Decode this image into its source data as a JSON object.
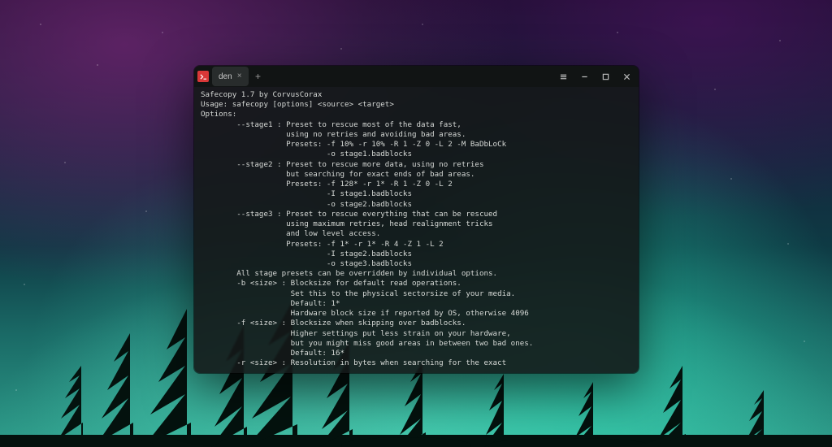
{
  "titlebar": {
    "tab_label": "den",
    "new_tab_tooltip": "+"
  },
  "terminal": {
    "lines": [
      "Safecopy 1.7 by CorvusCorax",
      "Usage: safecopy [options] <source> <target>",
      "Options:",
      "        --stage1 : Preset to rescue most of the data fast,",
      "                   using no retries and avoiding bad areas.",
      "                   Presets: -f 10% -r 10% -R 1 -Z 0 -L 2 -M BaDbLoCk",
      "                            -o stage1.badblocks",
      "        --stage2 : Preset to rescue more data, using no retries",
      "                   but searching for exact ends of bad areas.",
      "                   Presets: -f 128* -r 1* -R 1 -Z 0 -L 2",
      "                            -I stage1.badblocks",
      "                            -o stage2.badblocks",
      "        --stage3 : Preset to rescue everything that can be rescued",
      "                   using maximum retries, head realignment tricks",
      "                   and low level access.",
      "                   Presets: -f 1* -r 1* -R 4 -Z 1 -L 2",
      "                            -I stage2.badblocks",
      "                            -o stage3.badblocks",
      "        All stage presets can be overridden by individual options.",
      "        -b <size> : Blocksize for default read operations.",
      "                    Set this to the physical sectorsize of your media.",
      "                    Default: 1*",
      "                    Hardware block size if reported by OS, otherwise 4096",
      "        -f <size> : Blocksize when skipping over badblocks.",
      "                    Higher settings put less strain on your hardware,",
      "                    but you might miss good areas in between two bad ones.",
      "                    Default: 16*",
      "        -r <size> : Resolution in bytes when searching for the exact"
    ]
  },
  "colors": {
    "terminal_fg": "#d6d9d6",
    "terminal_bg": "rgba(20,24,24,0.9)",
    "app_icon_bg": "#d93838"
  }
}
